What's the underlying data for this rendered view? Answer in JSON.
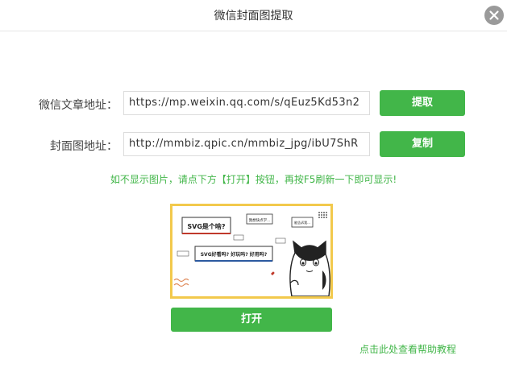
{
  "dialog": {
    "title": "微信封面图提取"
  },
  "article": {
    "label": "微信文章地址：",
    "value": "https://mp.weixin.qq.com/s/qEuz5Kd53n2",
    "button": "提取"
  },
  "cover": {
    "label": "封面图地址：",
    "value": "http://mmbiz.qpic.cn/mmbiz_jpg/ibU7ShR",
    "button": "复制"
  },
  "hint": "如不显示图片，请点下方【打开】按钮，再按F5刷新一下即可显示!",
  "preview": {
    "bubble_1": "SVG是个啥?",
    "bubble_2": "我想快点学...",
    "bubble_3": "SVG好看吗? 好玩吗? 好用吗?",
    "bubble_4": "能告诉我...",
    "accent_color": "#f2c94c"
  },
  "open_button": "打开",
  "help_link": "点击此处查看帮助教程",
  "colors": {
    "primary": "#42b649",
    "close": "#9a9a9a"
  }
}
